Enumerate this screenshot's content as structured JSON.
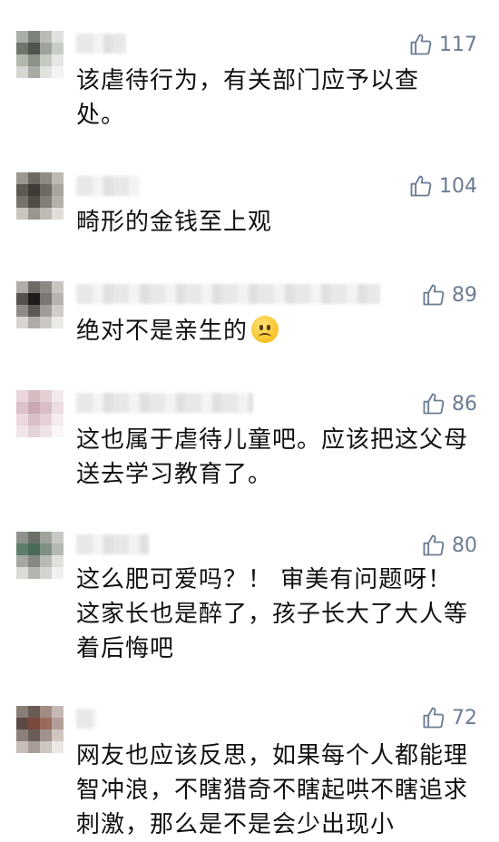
{
  "comments": [
    {
      "likes": "117",
      "text": "该虐待行为，有关部门应予以查处。"
    },
    {
      "likes": "104",
      "text": "畸形的金钱至上观"
    },
    {
      "likes": "89",
      "text": "绝对不是亲生的",
      "emoji": "frowning-face"
    },
    {
      "likes": "86",
      "text": "这也属于虐待儿童吧。应该把这父母送去学习教育了。"
    },
    {
      "likes": "80",
      "text": "这么肥可爱吗？！ 审美有问题呀！这家长也是醉了，孩子长大了大人等着后悔吧"
    },
    {
      "likes": "72",
      "text": "网友也应该反思，如果每个人都能理智冲浪，不瞎猎奇不瞎起哄不瞎追求刺激，那么是不是会少出现小"
    }
  ],
  "icons": {
    "like": "thumbs-up-icon"
  },
  "colors": {
    "like": "#6b7c93",
    "text": "#111111"
  }
}
